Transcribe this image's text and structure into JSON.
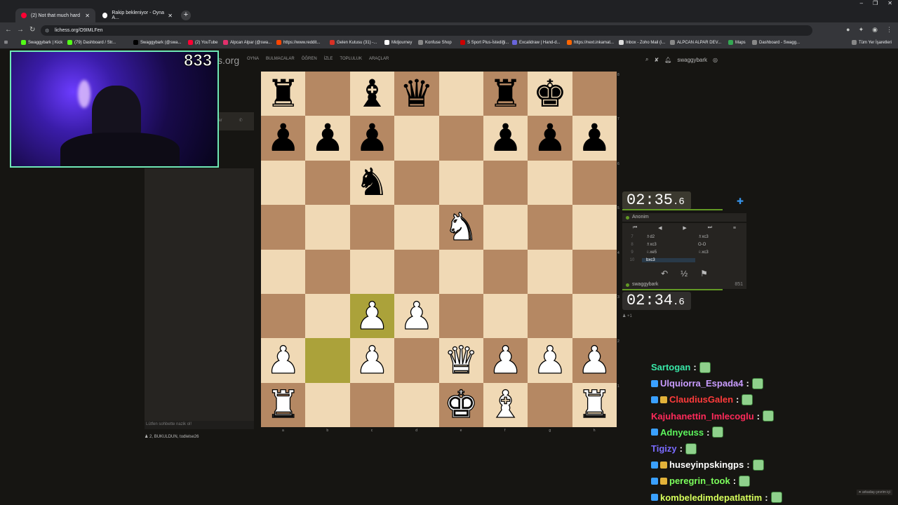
{
  "browser": {
    "tabs": [
      {
        "title": "(2) Not that much hard",
        "active": true,
        "icon_color": "#ff0033"
      },
      {
        "title": "Rakip bekleniyor - Oyna A...",
        "active": false,
        "icon_color": "#ffffff"
      }
    ],
    "url": "lichess.org/O9IMLFen",
    "bookmarks": [
      {
        "label": "Swaggybark | Kick",
        "color": "#53fc18"
      },
      {
        "label": "(79) Dashboard / Str...",
        "color": "#53fc18"
      },
      {
        "label": "Swaggybark (@swa...",
        "color": "#000000"
      },
      {
        "label": "(2) YouTube",
        "color": "#ff0033"
      },
      {
        "label": "Alpcan Alpar (@swa...",
        "color": "#e1306c"
      },
      {
        "label": "https://www.reddit...",
        "color": "#ff4500"
      },
      {
        "label": "Gelen Kutusu (31) -...",
        "color": "#d93025"
      },
      {
        "label": "Midjourney",
        "color": "#ffffff"
      },
      {
        "label": "Konfuse Shop",
        "color": "#888888"
      },
      {
        "label": "S Sport Plus-İstediği...",
        "color": "#cc0000"
      },
      {
        "label": "Excalidraw | Hand-d...",
        "color": "#6965db"
      },
      {
        "label": "https://next.inkamat...",
        "color": "#ff6600"
      },
      {
        "label": "Inbox - Zoho Mail (i...",
        "color": "#dddddd"
      },
      {
        "label": "ALPCAN ALPAR DEV...",
        "color": "#888888"
      },
      {
        "label": "Maps",
        "color": "#34a853"
      },
      {
        "label": "Dashboard - Swagg...",
        "color": "#888888"
      }
    ],
    "all_bookmarks": "Tüm Yer İşaretleri"
  },
  "lichess": {
    "logo": "s.org",
    "nav": [
      "OYNA",
      "BULMACALAR",
      "ÖĞREN",
      "İZLE",
      "TOPLULUK",
      "ARAÇLAR"
    ],
    "username": "swaggybark",
    "chat_tab": "lar",
    "chat_placeholder": "Lütfen sohbette nazik ol!",
    "spectators": "2, BUKULDUN, todlelse26"
  },
  "board": {
    "ranks": [
      "8",
      "7",
      "6",
      "5",
      "4",
      "3",
      "2",
      "1"
    ],
    "files": [
      "a",
      "b",
      "c",
      "d",
      "e",
      "f",
      "g",
      "h"
    ],
    "pieces": [
      "br",
      "",
      "bb",
      "bq",
      "",
      "br",
      "bk",
      "",
      "bp",
      "bp",
      "bp",
      "",
      "",
      "bp",
      "bp",
      "bp",
      "",
      "",
      "bn",
      "",
      "",
      "",
      "",
      "",
      "",
      "",
      "",
      "",
      "wn",
      "",
      "",
      "",
      "",
      "",
      "",
      "",
      "",
      "",
      "",
      "",
      "",
      "",
      "wp",
      "wp",
      "",
      "",
      "",
      "",
      "wp",
      "",
      "wp",
      "",
      "wq",
      "wp",
      "wp",
      "wp",
      "wr",
      "",
      "",
      "",
      "wk",
      "wb",
      "",
      "wr"
    ],
    "highlight": [
      42,
      49
    ]
  },
  "game": {
    "top_clock": {
      "main": "02:35",
      "tenths": ".6"
    },
    "bottom_clock": {
      "main": "02:34",
      "tenths": ".6"
    },
    "opponent": "Anonim",
    "player": "swaggybark",
    "player_rating": "851",
    "spectator_count": "+1",
    "moves": [
      {
        "n": "7",
        "w": "♗d2",
        "b": "♗xc3"
      },
      {
        "n": "8",
        "w": "♗xc3",
        "b": "O-O"
      },
      {
        "n": "9",
        "w": "♘xe5",
        "b": "♘xc3"
      },
      {
        "n": "10",
        "w": "bxc3",
        "b": ""
      }
    ],
    "draw_label": "½"
  },
  "stream": {
    "viewers": "833",
    "chat": [
      {
        "user": "Sartogan",
        "color": "#38e8a8"
      },
      {
        "user": "Ulquiorra_Espada4",
        "color": "#c99cff"
      },
      {
        "user": "ClaudiusGalen",
        "color": "#ff3b3b"
      },
      {
        "user": "Kajuhanettin_Imlecoglu",
        "color": "#ff2a5a"
      },
      {
        "user": "Adnyeuss",
        "color": "#5cf55c"
      },
      {
        "user": "Tigizy",
        "color": "#7a6bff"
      },
      {
        "user": "huseyinpskingps",
        "color": "#ffffff"
      },
      {
        "user": "peregrin_took",
        "color": "#7cff5c"
      },
      {
        "user": "kombeledimdepatlattim",
        "color": "#d7ff5c"
      }
    ],
    "friends_online": "arkadaş çevrim içi"
  },
  "colors": {
    "light_square": "#f0d9b5",
    "dark_square": "#b58863",
    "highlight": "#aba23a"
  }
}
